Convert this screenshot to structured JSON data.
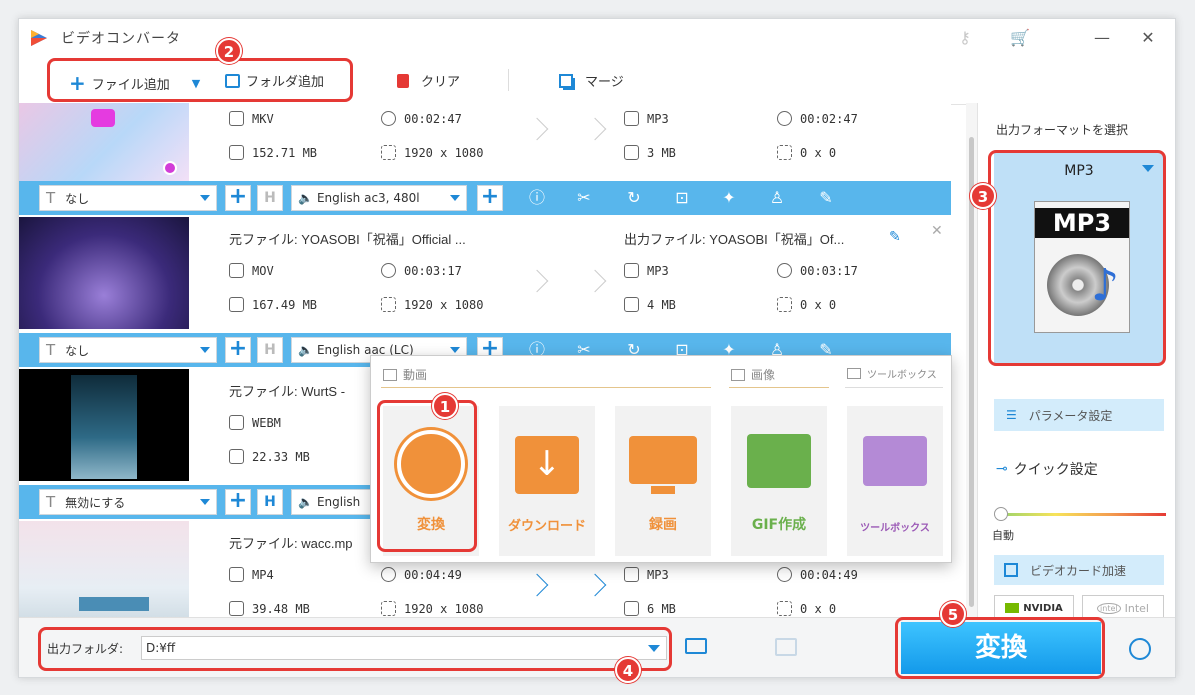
{
  "app": {
    "title": "ビデオコンバータ",
    "icons": [
      "key-icon",
      "cart-icon",
      "minimize-icon",
      "close-icon"
    ],
    "accent": "#58b6ec"
  },
  "toolbar": {
    "add_file": "ファイル追加",
    "add_folder": "フォルダ追加",
    "clear": "クリア",
    "merge": "マージ"
  },
  "files": [
    {
      "src_format": "MKV",
      "src_duration": "00:02:47",
      "src_size": "152.71 MB",
      "src_resolution": "1920 x 1080",
      "out_format": "MP3",
      "out_duration": "00:02:47",
      "out_size": "3 MB",
      "out_resolution": "0 x 0",
      "subtitle": "なし",
      "audio": "English ac3, 480l"
    },
    {
      "src_name": "元ファイル: YOASOBI「祝福」Official ...",
      "out_name": "出力ファイル: YOASOBI「祝福」Of...",
      "src_format": "MOV",
      "src_duration": "00:03:17",
      "src_size": "167.49 MB",
      "src_resolution": "1920 x 1080",
      "out_format": "MP3",
      "out_duration": "00:03:17",
      "out_size": "4 MB",
      "out_resolution": "0 x 0",
      "subtitle": "なし",
      "audio": "English aac (LC)"
    },
    {
      "src_name": "元ファイル: WurtS -",
      "src_format": "WEBM",
      "src_size": "22.33 MB",
      "subtitle": "無効にする",
      "audio": "English"
    },
    {
      "src_name": "元ファイル: wacc.mp",
      "src_format": "MP4",
      "src_duration": "00:04:49",
      "src_size": "39.48 MB",
      "src_resolution": "1920 x 1080",
      "out_format": "MP3",
      "out_duration": "00:04:49",
      "out_size": "6 MB",
      "out_resolution": "0 x 0"
    }
  ],
  "popup": {
    "tabs": {
      "video": "動画",
      "image": "画像",
      "toolbox": "ツールボックス"
    },
    "tiles": [
      {
        "label": "変換",
        "color": "#f0913a"
      },
      {
        "label": "ダウンロード",
        "color": "#f0913a"
      },
      {
        "label": "録画",
        "color": "#f0913a"
      },
      {
        "label": "GIF作成",
        "color": "#6ab04c"
      },
      {
        "label": "ツールボックス",
        "color": "#9b59b6"
      }
    ]
  },
  "right_panel": {
    "title": "出力フォーマットを選択",
    "format": "MP3",
    "format_icon_text": "MP3",
    "params": "パラメータ設定",
    "quick": "クイック設定",
    "auto": "自動",
    "gpu": "ビデオカード加速",
    "nvidia": "NVIDIA",
    "intel": "Intel"
  },
  "bottom": {
    "folder_label": "出力フォルダ:",
    "folder_value": "D:¥ff",
    "convert": "変換"
  },
  "badges": [
    "1",
    "2",
    "3",
    "4",
    "5"
  ]
}
